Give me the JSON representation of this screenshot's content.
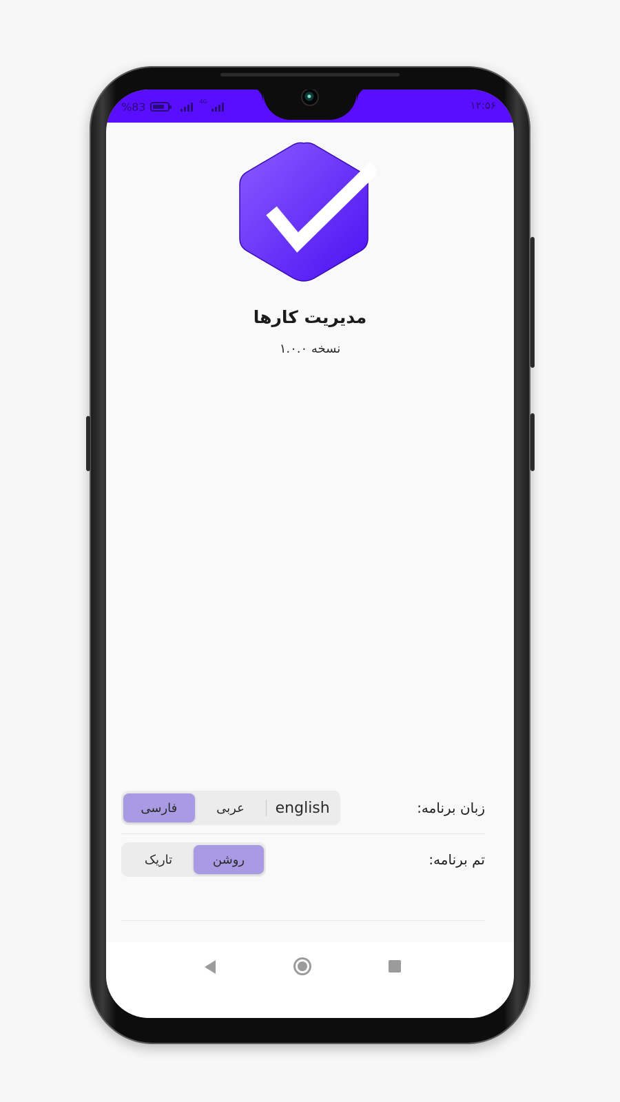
{
  "status_bar": {
    "battery_text": "%83",
    "battery_level": 0.83,
    "network_label": "4G",
    "time": "۱۲:۵۶",
    "color": "#5a0eff"
  },
  "app": {
    "icon_name": "check-hexagon-icon",
    "title": "مدیریت کارها",
    "version": "نسخه ۱.۰.۰",
    "brand_color": "#6a2bff"
  },
  "settings": {
    "language": {
      "label": "زبان برنامه:",
      "options": [
        "english",
        "عربی",
        "فارسی"
      ],
      "selected": "فارسی"
    },
    "theme": {
      "label": "تم برنامه:",
      "options": [
        "تاریک",
        "روشن"
      ],
      "selected": "روشن"
    },
    "active_color": "#a89be3"
  },
  "nav_bar": {
    "icons": [
      "back-icon",
      "home-icon",
      "recents-icon"
    ]
  }
}
